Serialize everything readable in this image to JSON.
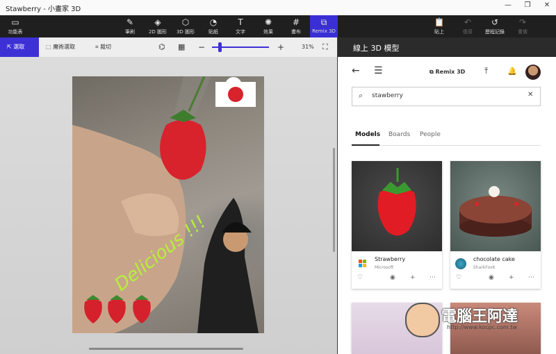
{
  "window": {
    "title": "Stawberry - 小畫家 3D",
    "minimize": "—",
    "maximize": "❐",
    "close": "✕"
  },
  "ribbon": {
    "menu_label": "功能表",
    "tools": [
      {
        "label": "筆刷",
        "icon": "brush-icon"
      },
      {
        "label": "2D 圖形",
        "icon": "shapes2d-icon"
      },
      {
        "label": "3D 圖形",
        "icon": "shapes3d-icon"
      },
      {
        "label": "貼紙",
        "icon": "sticker-icon"
      },
      {
        "label": "文字",
        "icon": "text-icon"
      },
      {
        "label": "效果",
        "icon": "effects-icon"
      },
      {
        "label": "畫布",
        "icon": "canvas-icon"
      },
      {
        "label": "Remix 3D",
        "icon": "remix3d-icon"
      }
    ],
    "right": [
      {
        "label": "貼上",
        "icon": "paste-icon"
      },
      {
        "label": "復原",
        "icon": "undo-icon"
      },
      {
        "label": "歷程記錄",
        "icon": "history-icon"
      },
      {
        "label": "重做",
        "icon": "redo-icon"
      }
    ]
  },
  "toolbar": {
    "select": "選取",
    "magic_select": "魔術選取",
    "crop": "裁切",
    "zoom_value": "31%"
  },
  "canvas": {
    "text_overlay": "Delicious !!!"
  },
  "panel": {
    "header": "線上 3D 模型",
    "brand": "Remix 3D",
    "search_value": "stawberry",
    "tabs": [
      {
        "label": "Models"
      },
      {
        "label": "Boards"
      },
      {
        "label": "People"
      }
    ],
    "cards": [
      {
        "name": "Strawberry",
        "author": "Microsoft",
        "bg": "#3a3a3a"
      },
      {
        "name": "chocolate cake",
        "author": "SharkFox6",
        "bg": "#5b6b66"
      }
    ]
  },
  "watermark": {
    "text": "電腦王阿達",
    "url": "http://www.kocpc.com.tw"
  }
}
